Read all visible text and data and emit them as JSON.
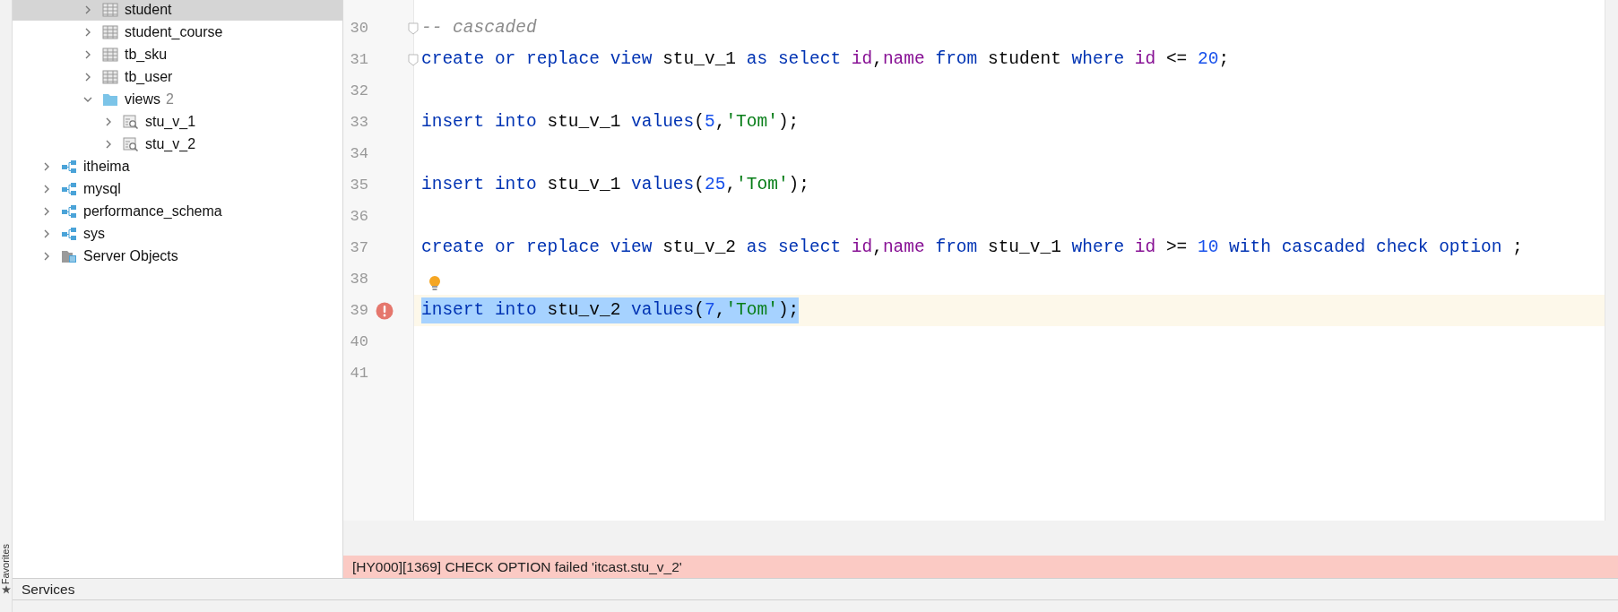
{
  "sidebar": {
    "visible_branch": [
      {
        "kind": "table",
        "label": "student",
        "selected": true,
        "expanded": false
      },
      {
        "kind": "table",
        "label": "student_course",
        "selected": false,
        "expanded": false
      },
      {
        "kind": "table",
        "label": "tb_sku",
        "selected": false,
        "expanded": false
      },
      {
        "kind": "table",
        "label": "tb_user",
        "selected": false,
        "expanded": false
      },
      {
        "kind": "folder",
        "label": "views",
        "count": "2",
        "selected": false,
        "expanded": true,
        "children": [
          {
            "kind": "view",
            "label": "stu_v_1",
            "selected": false,
            "expanded": false
          },
          {
            "kind": "view",
            "label": "stu_v_2",
            "selected": false,
            "expanded": false
          }
        ]
      }
    ],
    "roots": [
      {
        "kind": "schema",
        "label": "itheima",
        "selected": false,
        "expanded": false
      },
      {
        "kind": "schema",
        "label": "mysql",
        "selected": false,
        "expanded": false
      },
      {
        "kind": "schema",
        "label": "performance_schema",
        "selected": false,
        "expanded": false
      },
      {
        "kind": "schema",
        "label": "sys",
        "selected": false,
        "expanded": false
      },
      {
        "kind": "server",
        "label": "Server Objects",
        "selected": false,
        "expanded": false
      }
    ]
  },
  "editor": {
    "lines": [
      {
        "number": "30",
        "fold": true,
        "tokens": [
          {
            "kind": "comment",
            "text": "-- cascaded"
          }
        ]
      },
      {
        "number": "31",
        "fold": true,
        "tokens": [
          {
            "kind": "kw",
            "text": "create or replace view "
          },
          {
            "kind": "plain",
            "text": "stu_v_1 "
          },
          {
            "kind": "kw",
            "text": "as select "
          },
          {
            "kind": "field",
            "text": "id"
          },
          {
            "kind": "plain",
            "text": ","
          },
          {
            "kind": "field",
            "text": "name"
          },
          {
            "kind": "kw",
            "text": " from "
          },
          {
            "kind": "plain",
            "text": "student "
          },
          {
            "kind": "kw",
            "text": "where "
          },
          {
            "kind": "field",
            "text": "id"
          },
          {
            "kind": "plain",
            "text": " <= "
          },
          {
            "kind": "number",
            "text": "20"
          },
          {
            "kind": "plain",
            "text": ";"
          }
        ]
      },
      {
        "number": "32"
      },
      {
        "number": "33",
        "tokens": [
          {
            "kind": "kw",
            "text": "insert into "
          },
          {
            "kind": "plain",
            "text": "stu_v_1 "
          },
          {
            "kind": "kw",
            "text": "values"
          },
          {
            "kind": "plain",
            "text": "("
          },
          {
            "kind": "number",
            "text": "5"
          },
          {
            "kind": "plain",
            "text": ","
          },
          {
            "kind": "string",
            "text": "'Tom'"
          },
          {
            "kind": "plain",
            "text": ");"
          }
        ]
      },
      {
        "number": "34"
      },
      {
        "number": "35",
        "tokens": [
          {
            "kind": "kw",
            "text": "insert into "
          },
          {
            "kind": "plain",
            "text": "stu_v_1 "
          },
          {
            "kind": "kw",
            "text": "values"
          },
          {
            "kind": "plain",
            "text": "("
          },
          {
            "kind": "number",
            "text": "25"
          },
          {
            "kind": "plain",
            "text": ","
          },
          {
            "kind": "string",
            "text": "'Tom'"
          },
          {
            "kind": "plain",
            "text": ");"
          }
        ]
      },
      {
        "number": "36"
      },
      {
        "number": "37",
        "tokens": [
          {
            "kind": "kw",
            "text": "create or replace view "
          },
          {
            "kind": "plain",
            "text": "stu_v_2 "
          },
          {
            "kind": "kw",
            "text": "as select "
          },
          {
            "kind": "field",
            "text": "id"
          },
          {
            "kind": "plain",
            "text": ","
          },
          {
            "kind": "field",
            "text": "name"
          },
          {
            "kind": "kw",
            "text": " from "
          },
          {
            "kind": "plain",
            "text": "stu_v_1 "
          },
          {
            "kind": "kw",
            "text": "where "
          },
          {
            "kind": "field",
            "text": "id"
          },
          {
            "kind": "plain",
            "text": " >= "
          },
          {
            "kind": "number",
            "text": "10"
          },
          {
            "kind": "kw",
            "text": " with cascaded check option "
          },
          {
            "kind": "plain",
            "text": ";"
          }
        ]
      },
      {
        "number": "38",
        "hint": true
      },
      {
        "number": "39",
        "error": true,
        "current": true,
        "selected": true,
        "tokens": [
          {
            "kind": "kw",
            "text": "insert into "
          },
          {
            "kind": "plain",
            "text": "stu_v_2 "
          },
          {
            "kind": "kw",
            "text": "values"
          },
          {
            "kind": "plain",
            "text": "("
          },
          {
            "kind": "number",
            "text": "7"
          },
          {
            "kind": "plain",
            "text": ","
          },
          {
            "kind": "string",
            "text": "'Tom'"
          },
          {
            "kind": "plain",
            "text": ");"
          }
        ]
      },
      {
        "number": "40"
      },
      {
        "number": "41"
      }
    ]
  },
  "error_bar": {
    "message": "[HY000][1369] CHECK OPTION failed 'itcast.stu_v_2'"
  },
  "side_stripe": {
    "label": "Favorites"
  },
  "services_bar": {
    "title": "Services"
  }
}
